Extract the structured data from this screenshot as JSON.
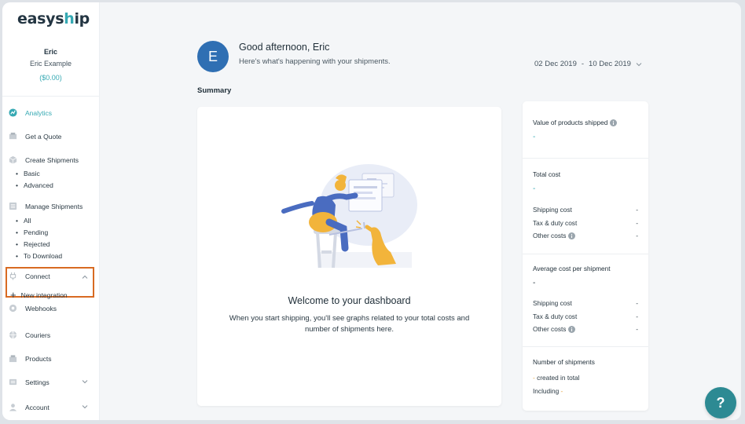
{
  "brand": {
    "logo_text_main": "easys",
    "logo_text_accent": "h",
    "logo_text_end": "ip"
  },
  "user": {
    "name": "Eric",
    "company": "Eric Example",
    "balance": "($0.00)",
    "avatar_letter": "E"
  },
  "sidebar": {
    "items": [
      {
        "label": "Analytics",
        "icon": "analytics-icon"
      },
      {
        "label": "Get a Quote",
        "icon": "quote-icon"
      },
      {
        "label": "Create Shipments",
        "icon": "box-icon"
      },
      {
        "label": "Manage Shipments",
        "icon": "list-icon"
      },
      {
        "label": "Connect",
        "icon": "plug-icon"
      },
      {
        "label": "Webhooks",
        "icon": "webhook-icon"
      },
      {
        "label": "Couriers",
        "icon": "globe-icon"
      },
      {
        "label": "Products",
        "icon": "products-icon"
      },
      {
        "label": "Settings",
        "icon": "settings-icon"
      },
      {
        "label": "Account",
        "icon": "account-icon"
      }
    ],
    "create_sub": [
      "Basic",
      "Advanced"
    ],
    "manage_sub": [
      "All",
      "Pending",
      "Rejected",
      "To Download"
    ],
    "connect_sub": {
      "new_integration": "New integration"
    }
  },
  "header": {
    "greeting": "Good afternoon, Eric",
    "subtitle": "Here's what's happening with your shipments.",
    "date_start": "02 Dec 2019",
    "date_sep": "-",
    "date_end": "10 Dec 2019"
  },
  "summary": {
    "title": "Summary",
    "welcome_title": "Welcome to your dashboard",
    "welcome_text": "When you start shipping, you'll see graphs related to your total costs and number of shipments here."
  },
  "stats": {
    "value_shipped": {
      "label": "Value of products shipped",
      "value": "-"
    },
    "total_cost": {
      "label": "Total cost",
      "value": "-",
      "rows": [
        {
          "label": "Shipping cost",
          "value": "-"
        },
        {
          "label": "Tax & duty cost",
          "value": "-"
        },
        {
          "label": "Other costs",
          "value": "-"
        }
      ]
    },
    "avg_cost": {
      "label": "Average cost per shipment",
      "value": "-",
      "rows": [
        {
          "label": "Shipping cost",
          "value": "-"
        },
        {
          "label": "Tax & duty cost",
          "value": "-"
        },
        {
          "label": "Other costs",
          "value": "-"
        }
      ]
    },
    "num_shipments": {
      "label": "Number of shipments",
      "created_dash": "-",
      "created_text": "created in total",
      "including_text": "Including",
      "including_dash": "-"
    }
  },
  "help": {
    "label": "?"
  },
  "colors": {
    "accent": "#36a9b3",
    "highlight": "#d86a22",
    "help_bg": "#2d8a93",
    "avatar_bg": "#2f6fb3"
  }
}
